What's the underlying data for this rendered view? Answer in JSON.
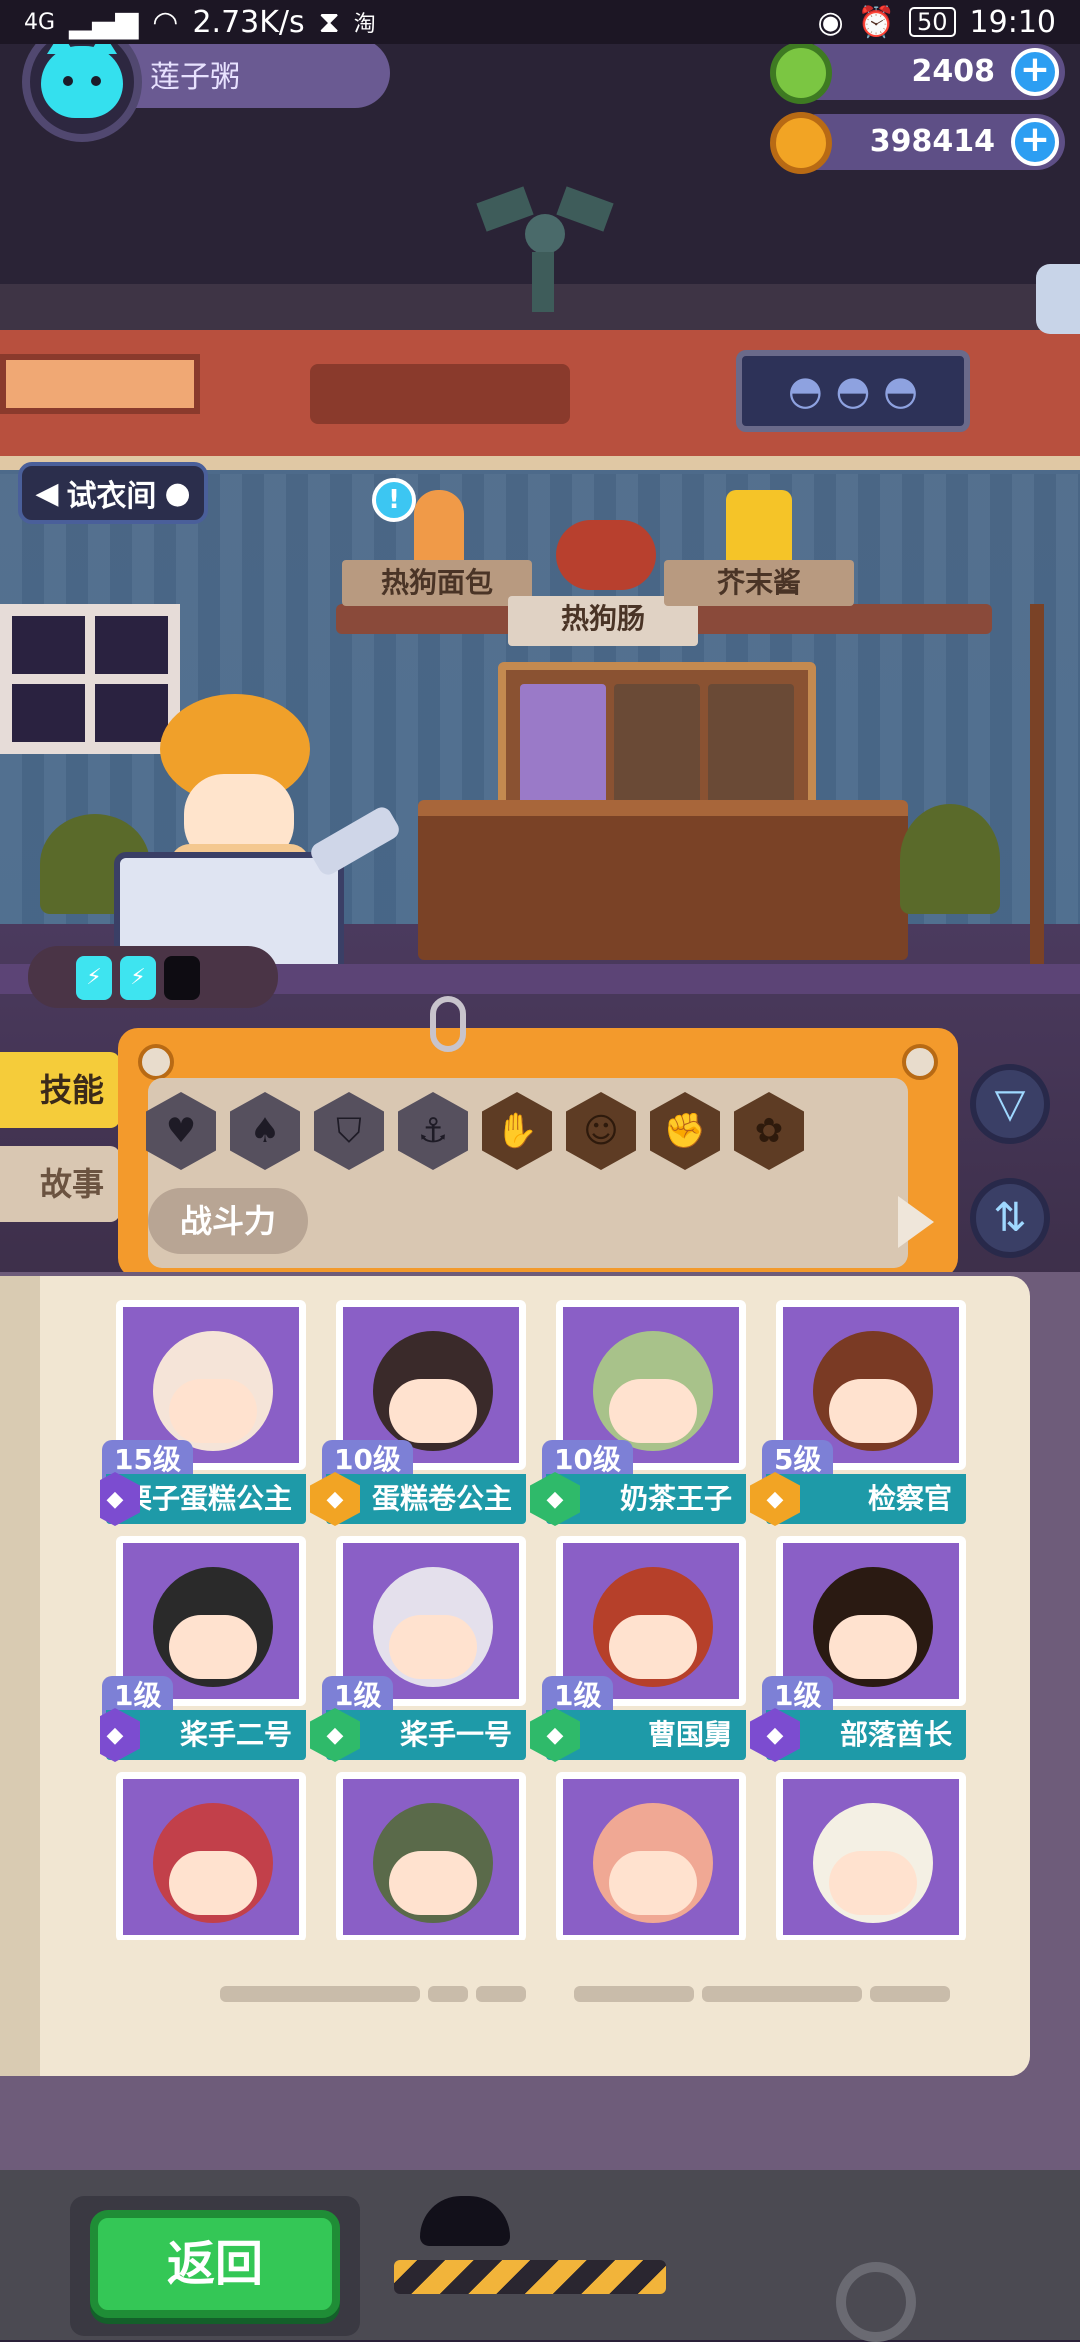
{
  "status_bar": {
    "network": "4G",
    "speed": "2.73K/s",
    "carrier_icon": "淘",
    "battery": "50",
    "time": "19:10"
  },
  "player": {
    "name": "莲子粥"
  },
  "currencies": [
    {
      "icon": "green-gem-coin",
      "value": "2408"
    },
    {
      "icon": "orange-planet-coin",
      "value": "398414"
    }
  ],
  "scene": {
    "dressing_room_label": "试衣间",
    "shelf_signs": [
      "热狗面包",
      "热狗肠",
      "芥末酱"
    ]
  },
  "side_tabs": {
    "skill": "技能",
    "story": "故事"
  },
  "filter": {
    "sort_label": "战斗力",
    "skill_icons": [
      "heart",
      "bell",
      "shield",
      "anchor",
      "hand",
      "smile",
      "arm",
      "brain"
    ]
  },
  "characters": [
    {
      "level": "15级",
      "name": "栗子蛋糕公主",
      "badge": "purple",
      "hair": "#f5e4d8"
    },
    {
      "level": "10级",
      "name": "蛋糕卷公主",
      "badge": "gold",
      "hair": "#3a2a2a"
    },
    {
      "level": "10级",
      "name": "奶茶王子",
      "badge": "green",
      "hair": "#a8c28a"
    },
    {
      "level": "5级",
      "name": "检察官",
      "badge": "gold",
      "hair": "#7a3a24"
    },
    {
      "level": "1级",
      "name": "桨手二号",
      "badge": "purple",
      "hair": "#2a2a2a"
    },
    {
      "level": "1级",
      "name": "桨手一号",
      "badge": "green",
      "hair": "#e4e0ec"
    },
    {
      "level": "1级",
      "name": "曹国舅",
      "badge": "green",
      "hair": "#b6402a"
    },
    {
      "level": "1级",
      "name": "部落酋长",
      "badge": "purple",
      "hair": "#2a1a12"
    },
    {
      "level": "",
      "name": "",
      "badge": "",
      "hair": "#c2404a"
    },
    {
      "level": "",
      "name": "",
      "badge": "",
      "hair": "#5a6a4a"
    },
    {
      "level": "",
      "name": "",
      "badge": "",
      "hair": "#f0a894"
    },
    {
      "level": "",
      "name": "",
      "badge": "",
      "hair": "#f4f0e4"
    }
  ],
  "bottom": {
    "back_label": "返回"
  }
}
